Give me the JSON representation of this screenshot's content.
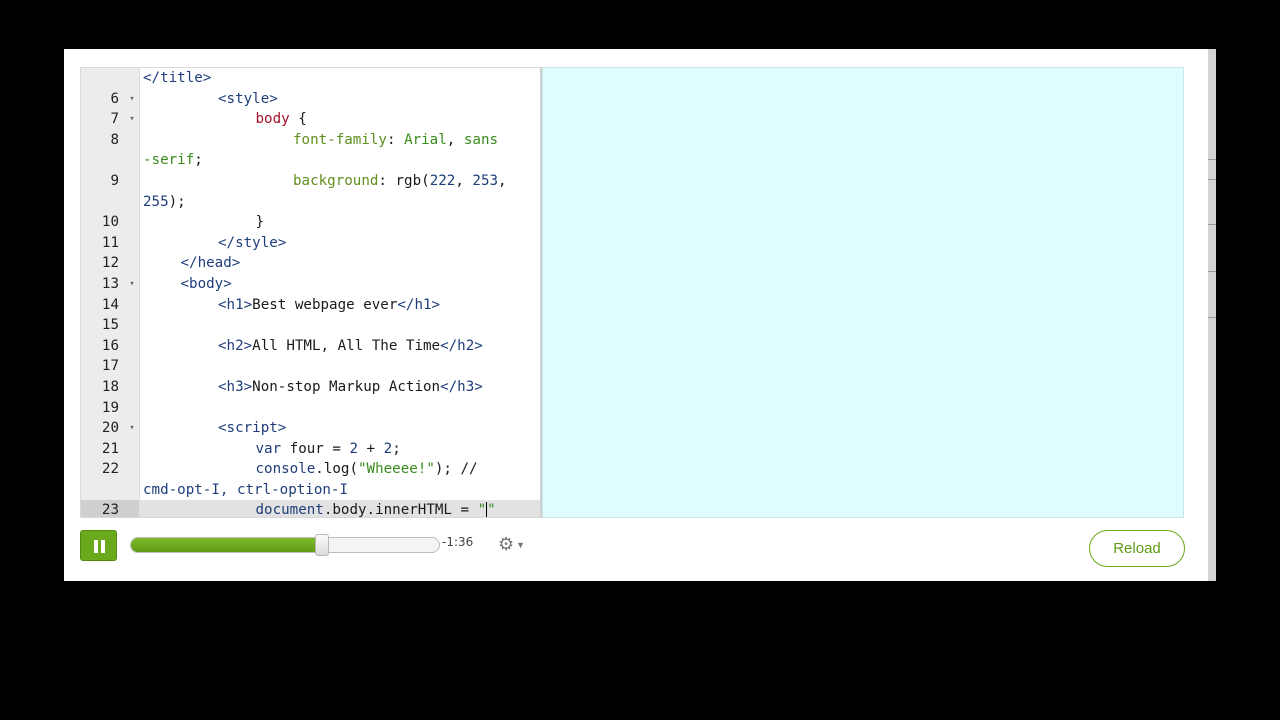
{
  "player": {
    "time_remaining": "-1:36",
    "progress": 0.62,
    "reload_label": "Reload"
  },
  "preview": {
    "background": "#defdff"
  },
  "editor": {
    "lines": [
      {
        "num": "",
        "fold": false,
        "indent": 0,
        "parts": [
          {
            "t": "</title>",
            "c": "tag"
          }
        ]
      },
      {
        "num": "6",
        "fold": true,
        "indent": 2,
        "parts": [
          {
            "t": "<style>",
            "c": "tag"
          }
        ]
      },
      {
        "num": "7",
        "fold": true,
        "indent": 3,
        "parts": [
          {
            "t": "body",
            "c": "sel"
          },
          {
            "t": " {",
            "c": ""
          }
        ]
      },
      {
        "num": "8",
        "fold": false,
        "indent": 4,
        "parts": [
          {
            "t": "font-family",
            "c": "prop"
          },
          {
            "t": ": ",
            "c": ""
          },
          {
            "t": "Arial",
            "c": "str"
          },
          {
            "t": ", ",
            "c": ""
          },
          {
            "t": "sans",
            "c": "str"
          }
        ]
      },
      {
        "num": "",
        "fold": false,
        "indent": 0,
        "parts": [
          {
            "t": "-serif",
            "c": "str"
          },
          {
            "t": ";",
            "c": ""
          }
        ]
      },
      {
        "num": "9",
        "fold": false,
        "indent": 4,
        "parts": [
          {
            "t": "background",
            "c": "prop"
          },
          {
            "t": ": ",
            "c": ""
          },
          {
            "t": "rgb(",
            "c": ""
          },
          {
            "t": "222",
            "c": "num"
          },
          {
            "t": ", ",
            "c": ""
          },
          {
            "t": "253",
            "c": "num"
          },
          {
            "t": ",",
            "c": ""
          }
        ]
      },
      {
        "num": "",
        "fold": false,
        "indent": 0,
        "parts": [
          {
            "t": "255",
            "c": "num"
          },
          {
            "t": ");",
            "c": ""
          }
        ]
      },
      {
        "num": "10",
        "fold": false,
        "indent": 3,
        "parts": [
          {
            "t": "}",
            "c": ""
          }
        ]
      },
      {
        "num": "11",
        "fold": false,
        "indent": 2,
        "parts": [
          {
            "t": "</style>",
            "c": "tag"
          }
        ]
      },
      {
        "num": "12",
        "fold": false,
        "indent": 1,
        "parts": [
          {
            "t": "</head>",
            "c": "tag"
          }
        ]
      },
      {
        "num": "13",
        "fold": true,
        "indent": 1,
        "parts": [
          {
            "t": "<body>",
            "c": "tag"
          }
        ]
      },
      {
        "num": "14",
        "fold": false,
        "indent": 2,
        "parts": [
          {
            "t": "<h1>",
            "c": "tag"
          },
          {
            "t": "Best webpage ever",
            "c": ""
          },
          {
            "t": "</h1>",
            "c": "tag"
          }
        ]
      },
      {
        "num": "15",
        "fold": false,
        "indent": 0,
        "parts": []
      },
      {
        "num": "16",
        "fold": false,
        "indent": 2,
        "parts": [
          {
            "t": "<h2>",
            "c": "tag"
          },
          {
            "t": "All HTML, All The Time",
            "c": ""
          },
          {
            "t": "</h2>",
            "c": "tag"
          }
        ]
      },
      {
        "num": "17",
        "fold": false,
        "indent": 0,
        "parts": []
      },
      {
        "num": "18",
        "fold": false,
        "indent": 2,
        "parts": [
          {
            "t": "<h3>",
            "c": "tag"
          },
          {
            "t": "Non-stop Markup Action",
            "c": ""
          },
          {
            "t": "</h3>",
            "c": "tag"
          }
        ]
      },
      {
        "num": "19",
        "fold": false,
        "indent": 0,
        "parts": []
      },
      {
        "num": "20",
        "fold": true,
        "indent": 2,
        "parts": [
          {
            "t": "<script>",
            "c": "tag"
          }
        ]
      },
      {
        "num": "21",
        "fold": false,
        "indent": 3,
        "parts": [
          {
            "t": "var",
            "c": "kw"
          },
          {
            "t": " four = ",
            "c": ""
          },
          {
            "t": "2",
            "c": "num"
          },
          {
            "t": " + ",
            "c": ""
          },
          {
            "t": "2",
            "c": "num"
          },
          {
            "t": ";",
            "c": ""
          }
        ]
      },
      {
        "num": "22",
        "fold": false,
        "indent": 3,
        "parts": [
          {
            "t": "console",
            "c": "kw"
          },
          {
            "t": ".log(",
            "c": ""
          },
          {
            "t": "\"Wheeee!\"",
            "c": "str"
          },
          {
            "t": "); //",
            "c": ""
          }
        ]
      },
      {
        "num": "",
        "fold": false,
        "indent": 0,
        "parts": [
          {
            "t": "cmd-opt-I, ctrl-option-I",
            "c": "kw"
          }
        ]
      },
      {
        "num": "23",
        "fold": false,
        "indent": 3,
        "active": true,
        "cursor_after": 4,
        "parts": [
          {
            "t": "document",
            "c": "kw"
          },
          {
            "t": ".body.innerHTML = ",
            "c": ""
          },
          {
            "t": "\"",
            "c": "str"
          },
          {
            "t": "",
            "c": ""
          },
          {
            "t": "\"",
            "c": "str"
          }
        ]
      }
    ]
  }
}
